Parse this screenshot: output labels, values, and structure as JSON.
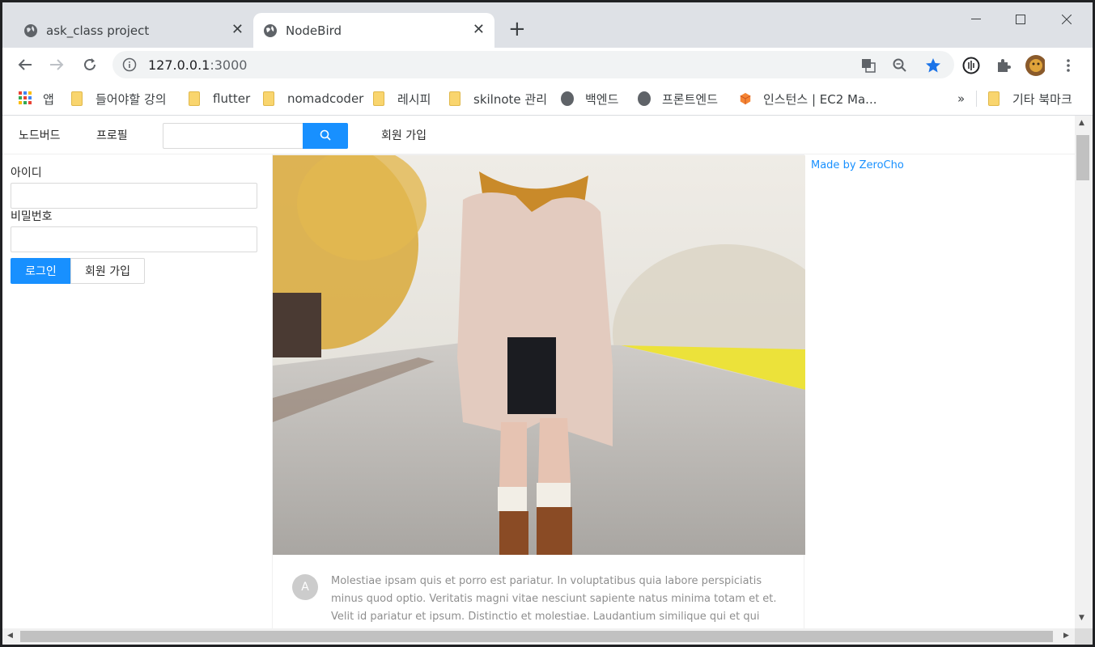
{
  "browser": {
    "tabs": [
      {
        "title": "ask_class project",
        "active": false,
        "icon": "globe-icon"
      },
      {
        "title": "NodeBird",
        "active": true,
        "icon": "globe-icon"
      }
    ],
    "url_host": "127.0.0.1",
    "url_port": ":3000",
    "bookmarks": [
      {
        "label": "앱",
        "icon": "apps-grid-icon"
      },
      {
        "label": "들어야할 강의",
        "icon": "folder-icon"
      },
      {
        "label": "flutter",
        "icon": "folder-icon"
      },
      {
        "label": "nomadcoder",
        "icon": "folder-icon"
      },
      {
        "label": "레시피",
        "icon": "folder-icon"
      },
      {
        "label": "skilnote 관리",
        "icon": "folder-icon"
      },
      {
        "label": "백엔드",
        "icon": "globe-icon"
      },
      {
        "label": "프론트엔드",
        "icon": "globe-icon"
      },
      {
        "label": "인스턴스 | EC2 Ma...",
        "icon": "aws-icon"
      }
    ],
    "bookmarks_overflow": "»",
    "other_bookmarks": "기타 북마크",
    "accent_color": "#1a73e8"
  },
  "app": {
    "menu": {
      "home": "노드버드",
      "profile": "프로필",
      "search_placeholder": "",
      "signup": "회원 가입"
    },
    "login": {
      "id_label": "아이디",
      "password_label": "비밀번호",
      "login_button": "로그인",
      "signup_button": "회원 가입"
    },
    "post": {
      "avatar_letter": "A",
      "content": "Molestiae ipsam quis et porro est pariatur. In voluptatibus quia labore perspiciatis minus quod optio. Veritatis magni vitae nesciunt sapiente natus minima totam et et. Velit id pariatur et ipsum. Distinctio et molestiae. Laudantium similique qui et qui placeat dolorem."
    },
    "made_by": "Made by ZeroCho",
    "primary_color": "#1890ff"
  }
}
